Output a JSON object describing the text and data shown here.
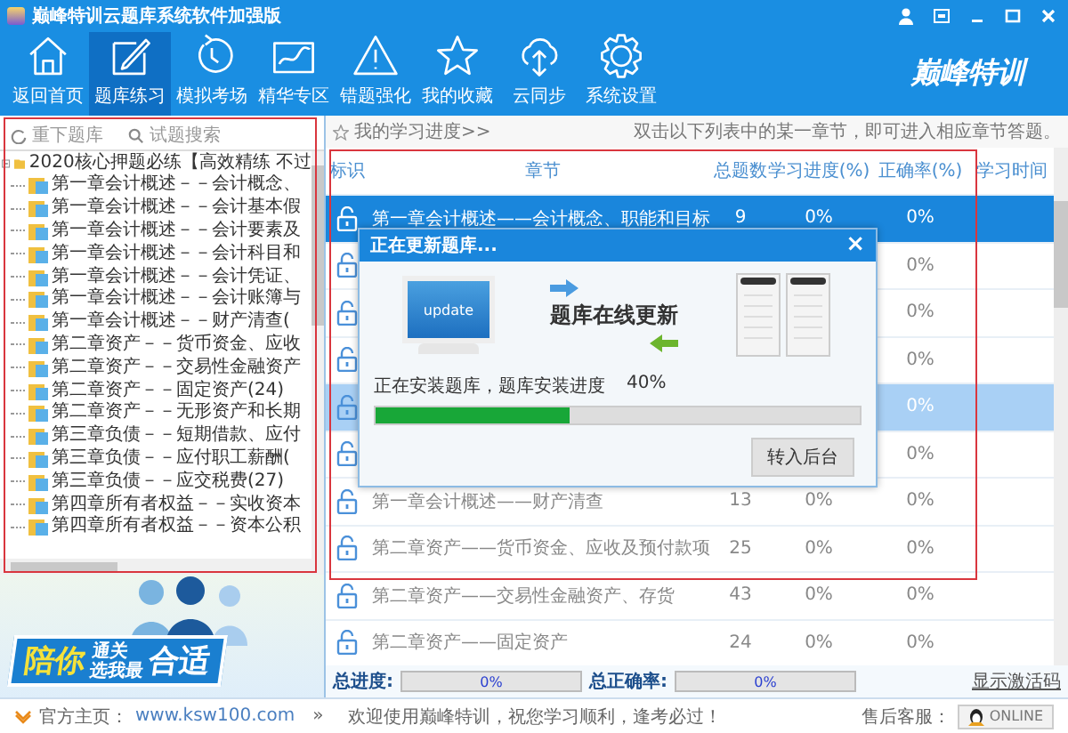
{
  "window": {
    "title": "巅峰特训云题库系统软件加强版"
  },
  "toolbar": {
    "items": [
      {
        "label": "返回首页",
        "selected": false
      },
      {
        "label": "题库练习",
        "selected": true
      },
      {
        "label": "模拟考场",
        "selected": false
      },
      {
        "label": "精华专区",
        "selected": false
      },
      {
        "label": "错题强化",
        "selected": false
      },
      {
        "label": "我的收藏",
        "selected": false
      },
      {
        "label": "云同步",
        "selected": false
      },
      {
        "label": "系统设置",
        "selected": false
      }
    ],
    "logo": "巅峰特训"
  },
  "sidebar": {
    "actions": [
      "重下题库",
      "试题搜索"
    ],
    "tree": {
      "label": "2020核心押题必练【高效精练 不过",
      "expanded": true,
      "children": [
        {
          "label": "第一章会计概述－－会计概念、"
        },
        {
          "label": "第一章会计概述－－会计基本假"
        },
        {
          "label": "第一章会计概述－－会计要素及"
        },
        {
          "label": "第一章会计概述－－会计科目和"
        },
        {
          "label": "第一章会计概述－－会计凭证、"
        },
        {
          "label": "第一章会计概述－－会计账簿与"
        },
        {
          "label": "第一章会计概述－－财产清查("
        },
        {
          "label": "第二章资产－－货币资金、应收"
        },
        {
          "label": "第二章资产－－交易性金融资产"
        },
        {
          "label": "第二章资产－－固定资产(24)"
        },
        {
          "label": "第二章资产－－无形资产和长期"
        },
        {
          "label": "第三章负债－－短期借款、应付"
        },
        {
          "label": "第三章负债－－应付职工薪酬("
        },
        {
          "label": "第三章负债－－应交税费(27)"
        },
        {
          "label": "第四章所有者权益－－实收资本"
        },
        {
          "label": "第四章所有者权益－－资本公积"
        }
      ]
    }
  },
  "banner": {
    "texts": [
      "陪你",
      "通关",
      "选我最",
      "合适"
    ]
  },
  "progress_panel": {
    "link": "我的学习进度>>",
    "hint": "双击以下列表中的某一章节，即可进入相应章节答题。",
    "columns": [
      "标识",
      "章节",
      "总题数",
      "学习进度(%)",
      "正确率(%)",
      "学习时间"
    ],
    "rows": [
      {
        "selected": true,
        "highlighted": false,
        "chapter": "第一章会计概述——会计概念、职能和目标",
        "total": "9",
        "progress": "0%",
        "accuracy": "0%"
      },
      {
        "selected": false,
        "highlighted": false,
        "accuracy": "0%"
      },
      {
        "selected": false,
        "highlighted": false,
        "accuracy": "0%"
      },
      {
        "selected": false,
        "highlighted": false,
        "accuracy": "0%"
      },
      {
        "selected": false,
        "highlighted": true,
        "accuracy": "0%"
      },
      {
        "selected": false,
        "highlighted": false,
        "accuracy": "0%"
      },
      {
        "selected": false,
        "highlighted": false,
        "chapter": "第一章会计概述——财产清查",
        "total": "13",
        "progress": "0%",
        "accuracy": "0%"
      },
      {
        "selected": false,
        "highlighted": false,
        "chapter": "第二章资产——货币资金、应收及预付款项",
        "total": "25",
        "progress": "0%",
        "accuracy": "0%"
      },
      {
        "selected": false,
        "highlighted": false,
        "chapter": "第二章资产——交易性金融资产、存货",
        "total": "43",
        "progress": "0%",
        "accuracy": "0%"
      },
      {
        "selected": false,
        "highlighted": false,
        "chapter": "第二章资产——固定资产",
        "total": "24",
        "progress": "0%",
        "accuracy": "0%"
      }
    ],
    "summary": {
      "progress_label": "总进度:",
      "progress": {
        "level": 0,
        "reading": "0%"
      },
      "accuracy_label": "总正确率:",
      "accuracy": {
        "level": 0,
        "reading": "0%"
      },
      "activation_link": "显示激活码"
    }
  },
  "dialog": {
    "title": "正在更新题库...",
    "close": "×",
    "screen_label": "update",
    "heading": "题库在线更新",
    "status": "正在安装题库，题库安装进度",
    "reading": "40%",
    "level": 0.4,
    "button": "转入后台"
  },
  "status_bar": {
    "home_label": "官方主页：",
    "home_url": "www.ksw100.com",
    "separator": "»",
    "message": "欢迎使用巅峰特训，祝您学习顺利，逢考必过！",
    "support_label": "售后客服：",
    "support_button": "ONLINE"
  }
}
